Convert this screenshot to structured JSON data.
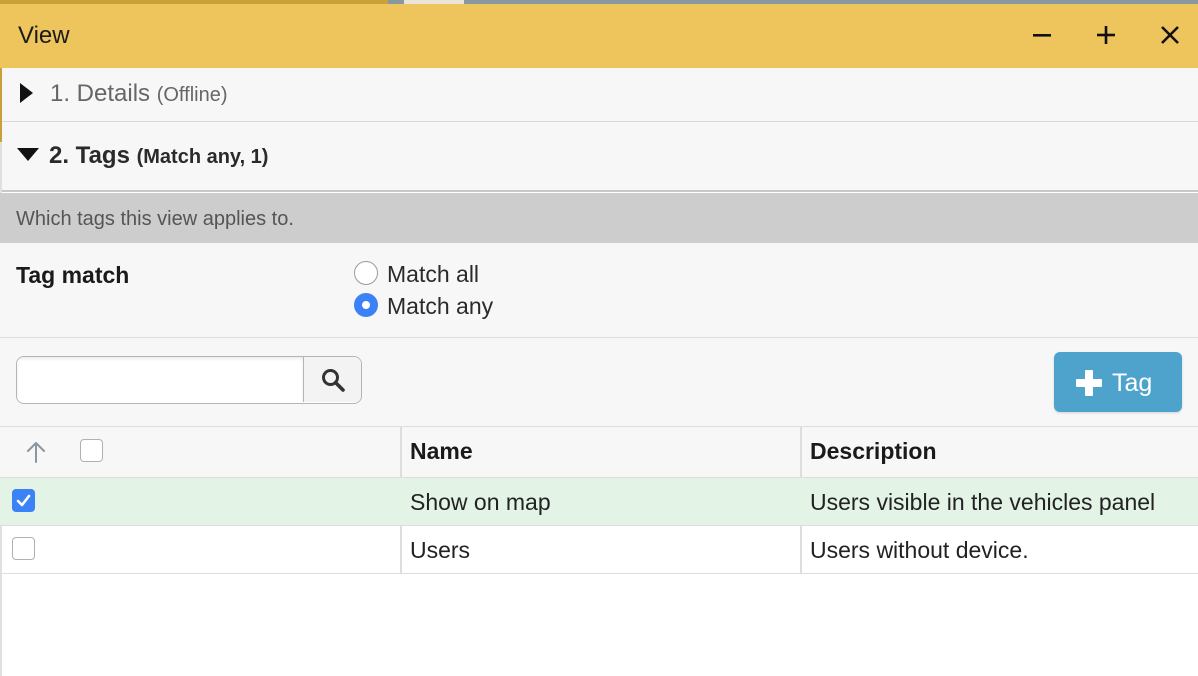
{
  "window": {
    "title": "View",
    "controls": [
      "minimize-icon",
      "maximize-icon",
      "close-icon"
    ]
  },
  "sections": [
    {
      "label": "1. Details",
      "sub": "(Offline)",
      "expanded": false
    },
    {
      "label": "2. Tags",
      "sub": "(Match any, 1)",
      "expanded": true
    }
  ],
  "tags_panel": {
    "description": "Which tags this view applies to.",
    "tag_match_label": "Tag match",
    "options": [
      {
        "label": "Match all",
        "selected": false
      },
      {
        "label": "Match any",
        "selected": true
      }
    ],
    "search": {
      "value": "",
      "placeholder": ""
    },
    "add_button_label": "Tag"
  },
  "grid": {
    "columns": [
      "Name",
      "Description"
    ],
    "rows": [
      {
        "checked": true,
        "name": "Show on map",
        "description": "Users visible in the vehicles panel"
      },
      {
        "checked": false,
        "name": "Users",
        "description": "Users without device."
      }
    ]
  },
  "colors": {
    "titlebar": "#eec45d",
    "accent": "#3b82f6",
    "add_button": "#4ea3cc",
    "selected_row": "#e3f3e6"
  }
}
